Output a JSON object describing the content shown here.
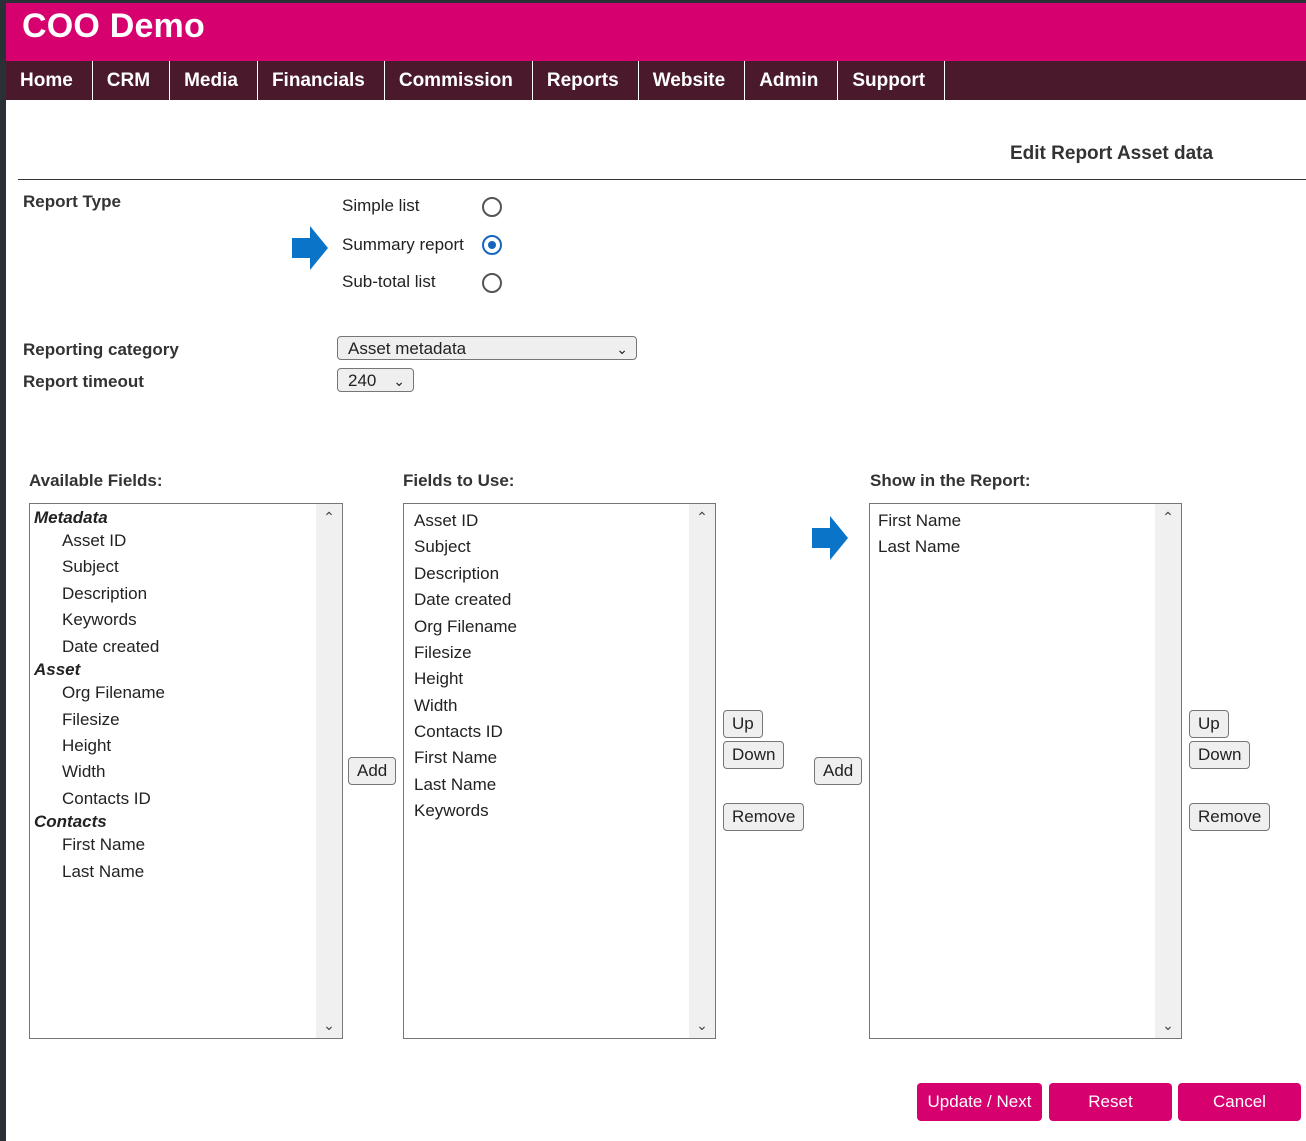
{
  "app": {
    "title": "COO Demo"
  },
  "nav": [
    "Home",
    "CRM",
    "Media",
    "Financials",
    "Commission",
    "Reports",
    "Website",
    "Admin",
    "Support"
  ],
  "page": {
    "heading": "Edit Report Asset data"
  },
  "report_type": {
    "label": "Report Type",
    "options": [
      {
        "label": "Simple list",
        "checked": false
      },
      {
        "label": "Summary report",
        "checked": true
      },
      {
        "label": "Sub-total list",
        "checked": false
      }
    ]
  },
  "reporting_category": {
    "label": "Reporting category",
    "value": "Asset metadata"
  },
  "report_timeout": {
    "label": "Report timeout",
    "value": "240"
  },
  "available_fields": {
    "label": "Available Fields:",
    "items": [
      "Metadata",
      "Asset ID",
      "Subject",
      "Description",
      "Keywords",
      "Date created",
      "Asset",
      "Org Filename",
      "Filesize",
      "Height",
      "Width",
      "Contacts ID",
      "Contacts",
      "First Name",
      "Last Name"
    ]
  },
  "fields_to_use": {
    "label": "Fields to Use:",
    "items": [
      "Asset ID",
      "Subject",
      "Description",
      "Date created",
      "Org Filename",
      "Filesize",
      "Height",
      "Width",
      "Contacts ID",
      "First Name",
      "Last Name",
      "Keywords"
    ]
  },
  "show_in_report": {
    "label": "Show in the Report:",
    "items": [
      "First Name",
      "Last Name"
    ]
  },
  "buttons": {
    "add": "Add",
    "up": "Up",
    "down": "Down",
    "remove": "Remove",
    "update_next": "Update / Next",
    "reset": "Reset",
    "cancel": "Cancel"
  },
  "colors": {
    "brand": "#d6006f",
    "nav_bg": "#4a1a2c",
    "arrow": "#0a74c9"
  }
}
